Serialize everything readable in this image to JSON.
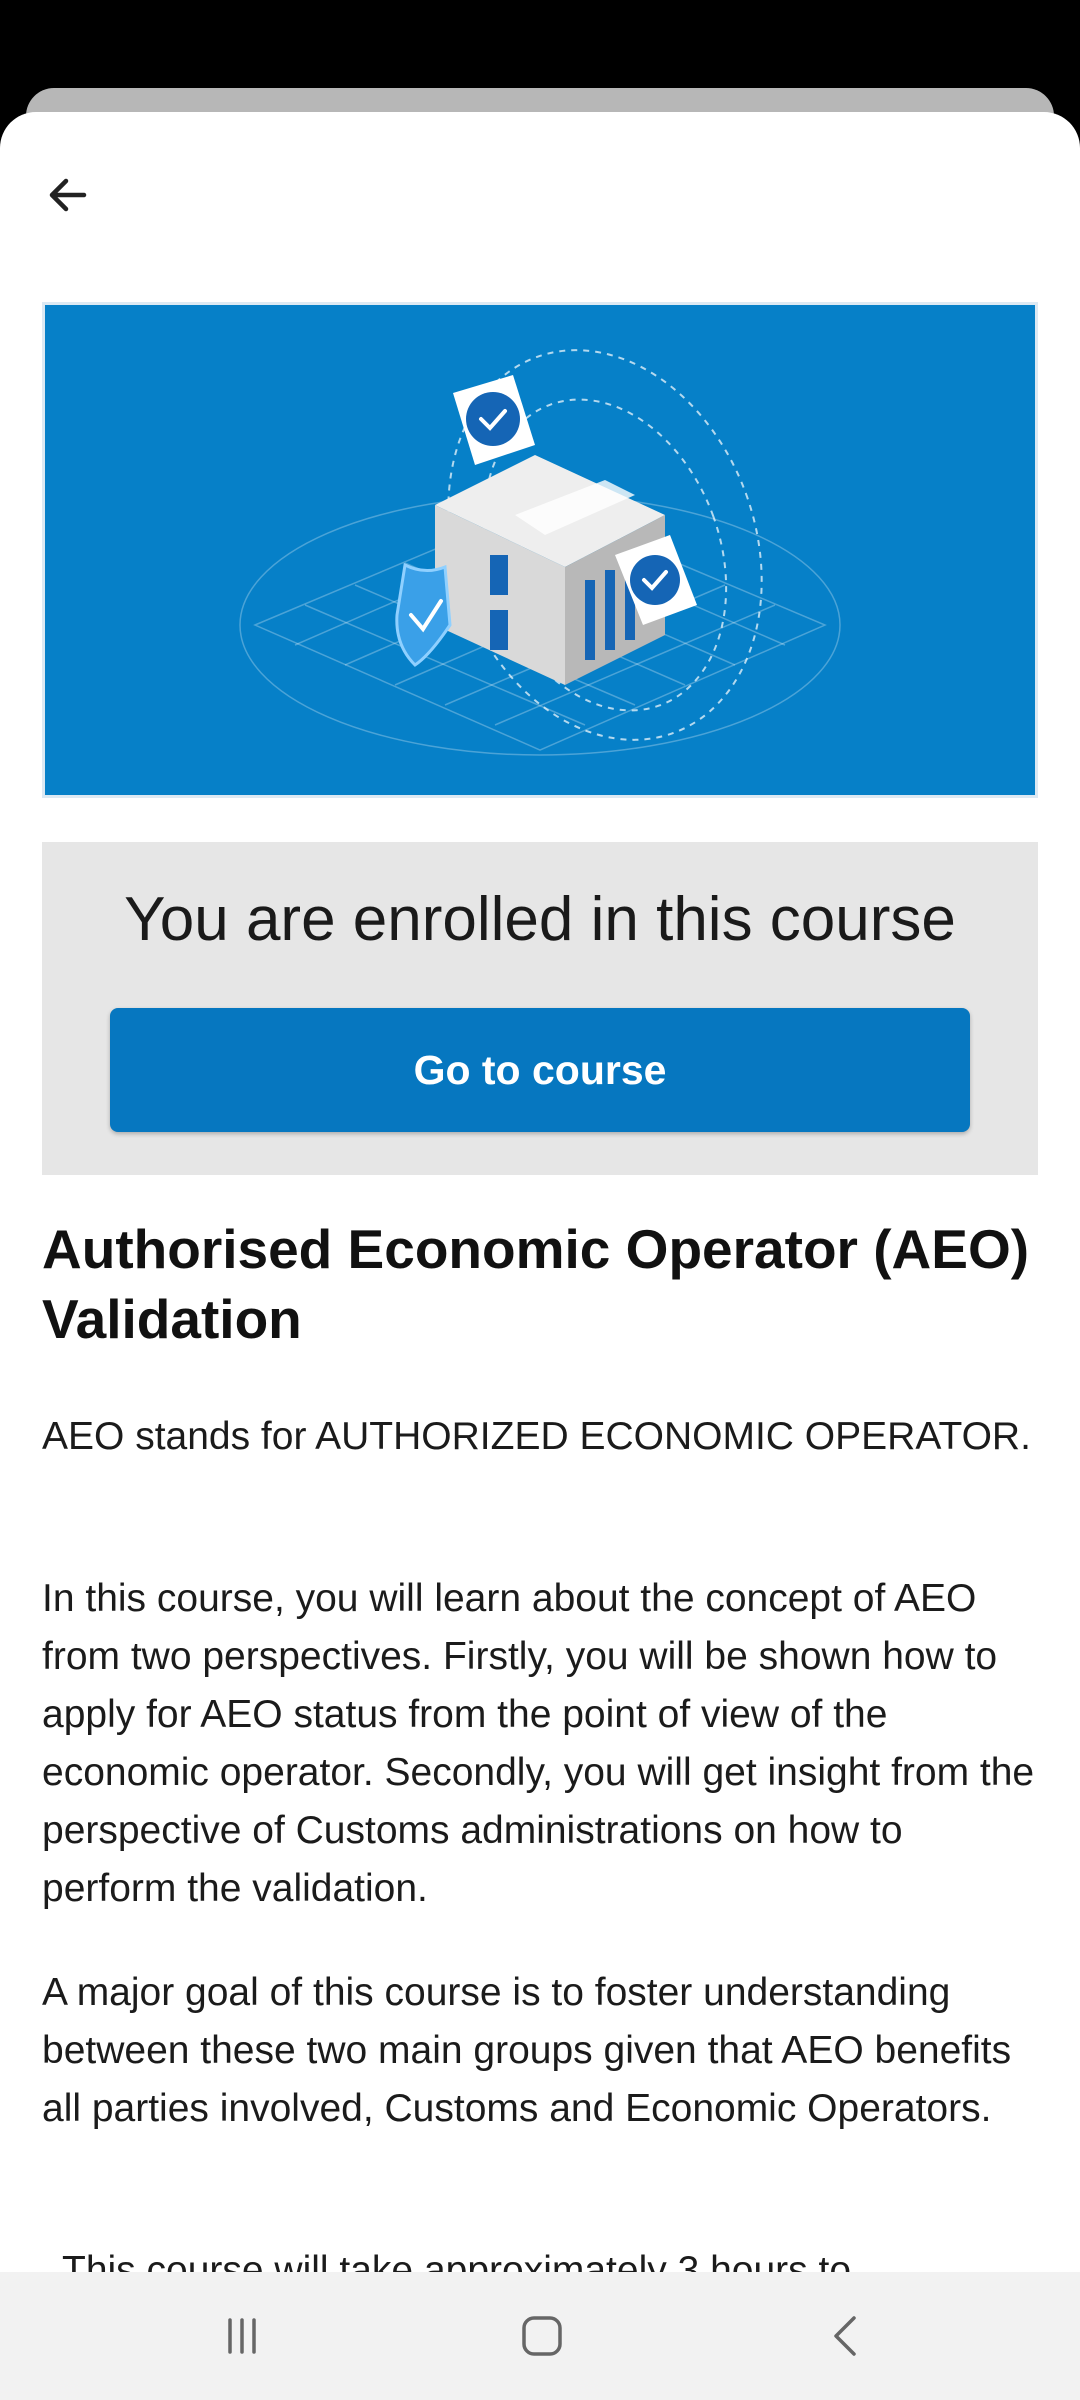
{
  "header": {
    "back_icon": "arrow-left-icon"
  },
  "enrollment": {
    "title": "You are enrolled in this course",
    "button_label": "Go to course",
    "accent": "#0677c0"
  },
  "course": {
    "title": "Authorised Economic Operator (AEO) Validation",
    "paragraphs": [
      "AEO stands for AUTHORIZED ECONOMIC OPERATOR.",
      "In this course, you will learn about the concept of AEO from two perspectives. Firstly, you will be shown how to apply for AEO status from the point of view of the economic operator. Secondly, you will get insight from the perspective of Customs administrations on how to perform the validation.",
      "A major goal of this course is to foster understanding between these two main groups given that AEO benefits all parties involved, Customs and Economic Operators.",
      "This course will take approximately 3 hours to"
    ]
  },
  "navigation": {
    "recents_icon": "recent-apps-icon",
    "home_icon": "home-icon",
    "back_icon": "back-chevron-icon"
  }
}
